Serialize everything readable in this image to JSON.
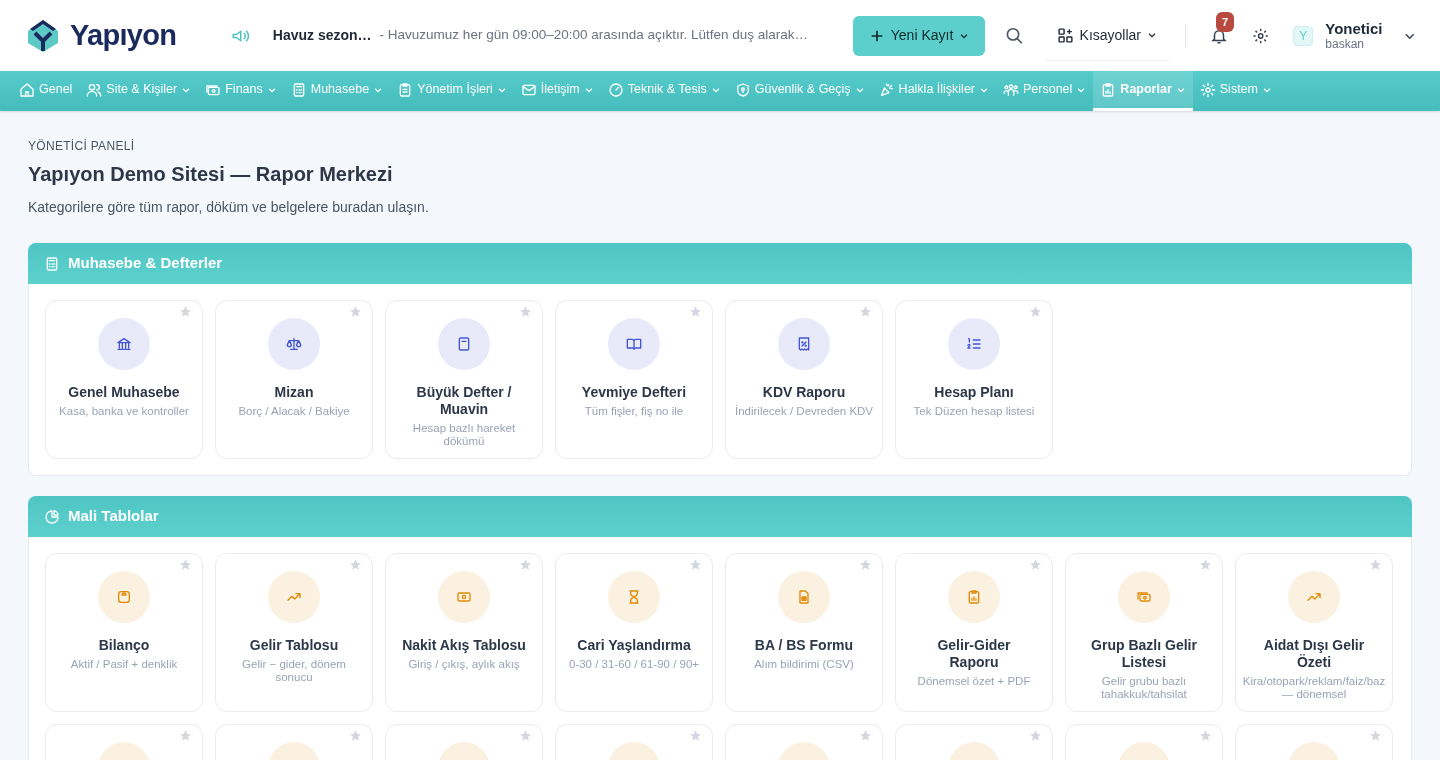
{
  "header": {
    "logo": "Yapıyon",
    "announcement": {
      "title": "Havuz sezon…",
      "text": "- Havuzumuz her gün 09:00–20:00 arasında açıktır. Lütfen duş alarak…"
    },
    "new_button": "Yeni Kayıt",
    "shortcuts": "Kısayollar",
    "notifications": "7",
    "user": {
      "avatar": "Y",
      "name": "Yonetici",
      "role": "baskan"
    }
  },
  "nav": [
    {
      "label": "Genel",
      "dropdown": false,
      "selected": false
    },
    {
      "label": "Site & Kişiler",
      "dropdown": true,
      "selected": false
    },
    {
      "label": "Finans",
      "dropdown": true,
      "selected": false
    },
    {
      "label": "Muhasebe",
      "dropdown": true,
      "selected": false
    },
    {
      "label": "Yönetim İşleri",
      "dropdown": true,
      "selected": false
    },
    {
      "label": "İletişim",
      "dropdown": true,
      "selected": false
    },
    {
      "label": "Teknik & Tesis",
      "dropdown": true,
      "selected": false
    },
    {
      "label": "Güvenlik & Geçiş",
      "dropdown": true,
      "selected": false
    },
    {
      "label": "Halkla İlişkiler",
      "dropdown": true,
      "selected": false
    },
    {
      "label": "Personel",
      "dropdown": true,
      "selected": false
    },
    {
      "label": "Raporlar",
      "dropdown": true,
      "selected": true
    },
    {
      "label": "Sistem",
      "dropdown": true,
      "selected": false
    }
  ],
  "page": {
    "eyebrow": "YÖNETİCİ PANELİ",
    "title": "Yapıyon Demo Sitesi — Rapor Merkezi",
    "subtitle": "Kategorilere göre tüm rapor, döküm ve belgelere buradan ulaşın."
  },
  "sections": [
    {
      "title": "Muhasebe & Defterler",
      "color": "#4355d1",
      "cards": [
        {
          "title": "Genel Muhasebe",
          "description": "Kasa, banka ve kontroller",
          "favorite": false
        },
        {
          "title": "Mizan",
          "description": "Borç / Alacak / Bakiye",
          "favorite": false
        },
        {
          "title": "Büyük Defter / Muavin",
          "description": "Hesap bazlı hareket dökümü",
          "favorite": false
        },
        {
          "title": "Yevmiye Defteri",
          "description": "Tüm fişler, fiş no ile",
          "favorite": false
        },
        {
          "title": "KDV Raporu",
          "description": "İndirilecek / Devreden KDV",
          "favorite": false
        },
        {
          "title": "Hesap Planı",
          "description": "Tek Düzen hesap listesi",
          "favorite": false
        }
      ]
    },
    {
      "title": "Mali Tablolar",
      "color": "#e08a06",
      "cards": [
        {
          "title": "Bilanço",
          "description": "Aktif / Pasif + denklik",
          "favorite": false
        },
        {
          "title": "Gelir Tablosu",
          "description": "Gelir − gider, dönem sonucu",
          "favorite": false
        },
        {
          "title": "Nakit Akış Tablosu",
          "description": "Giriş / çıkış, aylık akış",
          "favorite": false
        },
        {
          "title": "Cari Yaşlandırma",
          "description": "0-30 / 31-60 / 61-90 / 90+",
          "favorite": false
        },
        {
          "title": "BA / BS Formu",
          "description": "Alım bildirimi (CSV)",
          "favorite": false
        },
        {
          "title": "Gelir-Gider Raporu",
          "description": "Dönemsel özet + PDF",
          "favorite": false
        },
        {
          "title": "Grup Bazlı Gelir Listesi",
          "description": "Gelir grubu bazlı tahakkuk/tahsilat",
          "favorite": false
        },
        {
          "title": "Aidat Dışı Gelir Özeti",
          "description": "Kira/otopark/reklam/faiz/baz — dönemsel",
          "favorite": false
        },
        {
          "favorite": false
        },
        {
          "favorite": false
        },
        {
          "favorite": false
        },
        {
          "favorite": false
        },
        {
          "favorite": false
        },
        {
          "favorite": false
        },
        {
          "favorite": false
        },
        {
          "favorite": false
        }
      ]
    }
  ]
}
